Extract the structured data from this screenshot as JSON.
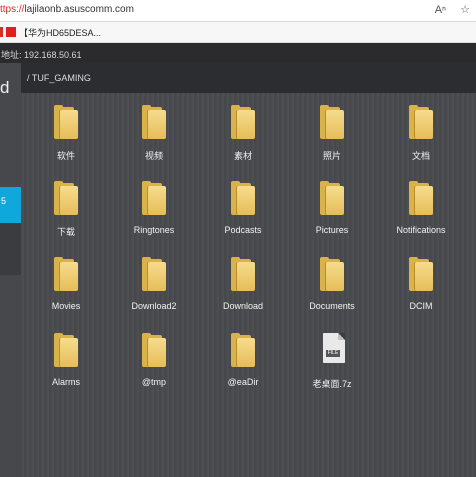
{
  "browser": {
    "url_scheme": "ttps://",
    "url_host": "lajilaonb.asuscomm.com",
    "icons": [
      "read-aloud-icon",
      "favorite-add-icon"
    ]
  },
  "favorites": {
    "item_label": "【华为HD65DESA..."
  },
  "address_bar": {
    "text": "地址: 192.168.50.61"
  },
  "left_panel": {
    "letter": "d",
    "item_label": "5"
  },
  "path": {
    "label": "/ TUF_GAMING"
  },
  "files": [
    {
      "name": "软件",
      "type": "folder"
    },
    {
      "name": "视频",
      "type": "folder"
    },
    {
      "name": "素材",
      "type": "folder"
    },
    {
      "name": "照片",
      "type": "folder"
    },
    {
      "name": "文档",
      "type": "folder"
    },
    {
      "name": "下载",
      "type": "folder"
    },
    {
      "name": "Ringtones",
      "type": "folder"
    },
    {
      "name": "Podcasts",
      "type": "folder"
    },
    {
      "name": "Pictures",
      "type": "folder"
    },
    {
      "name": "Notifications",
      "type": "folder"
    },
    {
      "name": "Movies",
      "type": "folder"
    },
    {
      "name": "Download2",
      "type": "folder"
    },
    {
      "name": "Download",
      "type": "folder"
    },
    {
      "name": "Documents",
      "type": "folder"
    },
    {
      "name": "DCIM",
      "type": "folder"
    },
    {
      "name": "Alarms",
      "type": "folder"
    },
    {
      "name": "@tmp",
      "type": "folder"
    },
    {
      "name": "@eaDir",
      "type": "folder"
    },
    {
      "name": "老桌面.7z",
      "type": "file",
      "badge": "FILE"
    }
  ],
  "colors": {
    "accent": "#10a8dc",
    "folder": "#e6bd58"
  }
}
